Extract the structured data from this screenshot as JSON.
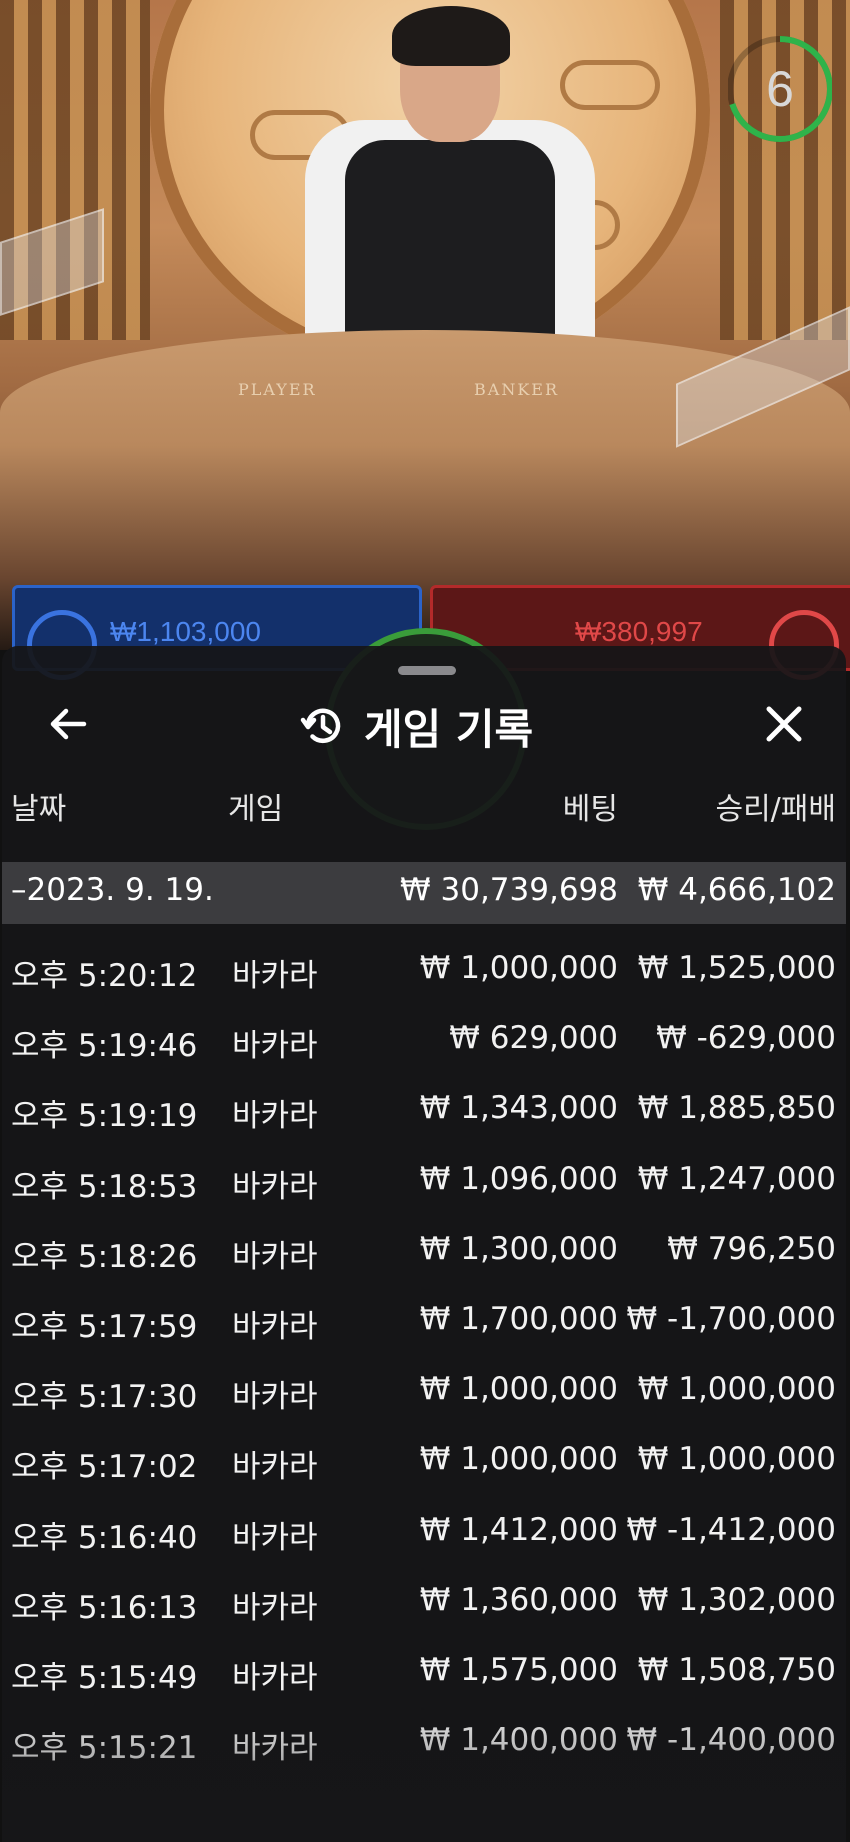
{
  "video": {
    "table_text_player": "PLAYER",
    "table_text_banker": "BANKER",
    "timer_value": "6",
    "timer_fraction": 0.7
  },
  "bet_panels": {
    "player_amount": "₩1,103,000",
    "banker_amount": "₩380,997"
  },
  "history_modal": {
    "title": "게임 기록",
    "columns": [
      "날짜",
      "게임",
      "베팅",
      "승리/패배"
    ],
    "date_summary": {
      "date": "–2023. 9. 19.",
      "bet_total": "₩ 30,739,698",
      "win_total": "₩ 4,666,102"
    },
    "rows": [
      {
        "time": "오후 5:20:12",
        "game": "바카라",
        "bet": "₩ 1,000,000",
        "result": "₩ 1,525,000"
      },
      {
        "time": "오후 5:19:46",
        "game": "바카라",
        "bet": "₩ 629,000",
        "result": "₩ -629,000"
      },
      {
        "time": "오후 5:19:19",
        "game": "바카라",
        "bet": "₩ 1,343,000",
        "result": "₩ 1,885,850"
      },
      {
        "time": "오후 5:18:53",
        "game": "바카라",
        "bet": "₩ 1,096,000",
        "result": "₩ 1,247,000"
      },
      {
        "time": "오후 5:18:26",
        "game": "바카라",
        "bet": "₩ 1,300,000",
        "result": "₩ 796,250"
      },
      {
        "time": "오후 5:17:59",
        "game": "바카라",
        "bet": "₩ 1,700,000",
        "result": "₩ -1,700,000"
      },
      {
        "time": "오후 5:17:30",
        "game": "바카라",
        "bet": "₩ 1,000,000",
        "result": "₩ 1,000,000"
      },
      {
        "time": "오후 5:17:02",
        "game": "바카라",
        "bet": "₩ 1,000,000",
        "result": "₩ 1,000,000"
      },
      {
        "time": "오후 5:16:40",
        "game": "바카라",
        "bet": "₩ 1,412,000",
        "result": "₩ -1,412,000"
      },
      {
        "time": "오후 5:16:13",
        "game": "바카라",
        "bet": "₩ 1,360,000",
        "result": "₩ 1,302,000"
      },
      {
        "time": "오후 5:15:49",
        "game": "바카라",
        "bet": "₩ 1,575,000",
        "result": "₩ 1,508,750"
      },
      {
        "time": "오후 5:15:21",
        "game": "바카라",
        "bet": "₩ 1,400,000",
        "result": "₩ -1,400,000"
      }
    ]
  },
  "colors": {
    "sheet_bg": "#161618",
    "date_row_bg": "#3c3c3f",
    "timer_ring": "#2fb34a",
    "player_blue": "#2b63c9",
    "banker_red": "#b32a2a"
  }
}
